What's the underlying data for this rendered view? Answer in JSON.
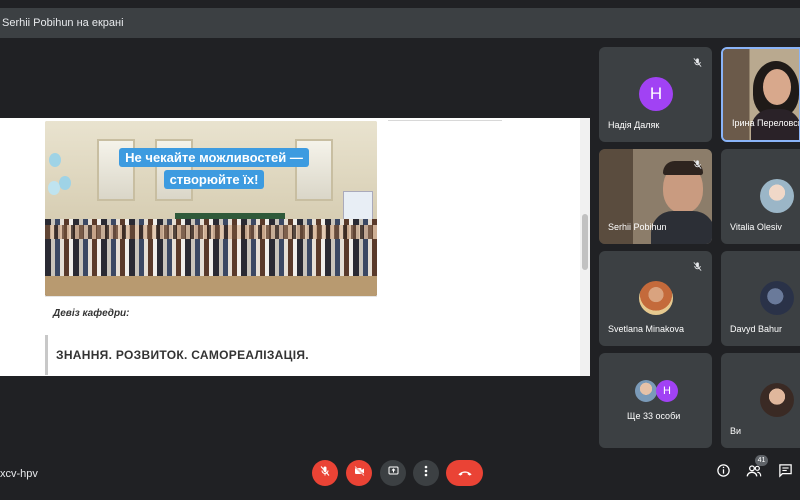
{
  "header": {
    "presenting_label": "Serhii Pobihun на екрані"
  },
  "presentation": {
    "banner_line1": "Не чекайте можливостей —",
    "banner_line2": "створюйте їх!",
    "motto_label": "Девіз кафедри:",
    "motto_text": "ЗНАННЯ. РОЗВИТОК. САМОРЕАЛІЗАЦІЯ."
  },
  "participants": [
    {
      "name": "Надія Даляк",
      "avatar_letter": "Н",
      "muted": true
    },
    {
      "name": "Ірина Переловськ",
      "muted": true,
      "speaking": true
    },
    {
      "name": "Serhii Pobihun",
      "muted": true
    },
    {
      "name": "Vitalia Olesiv"
    },
    {
      "name": "Svetlana Minakova",
      "muted": true
    },
    {
      "name": "Davyd Bahur"
    },
    {
      "name": "Ще 33 особи",
      "avatar_letter": "Н"
    },
    {
      "name": "Ви"
    }
  ],
  "footer": {
    "meeting_code": "xcv-hpv",
    "people_count": "41"
  },
  "colors": {
    "accent": "#8ab4f8",
    "danger": "#ea4335",
    "avatar_purple": "#a142f4",
    "tile_bg": "#3c4043",
    "page_bg": "#202124"
  },
  "icons": [
    "mic-off-icon",
    "camera-off-icon",
    "present-icon",
    "more-options-icon",
    "hang-up-icon",
    "info-icon",
    "people-icon",
    "chat-icon"
  ]
}
